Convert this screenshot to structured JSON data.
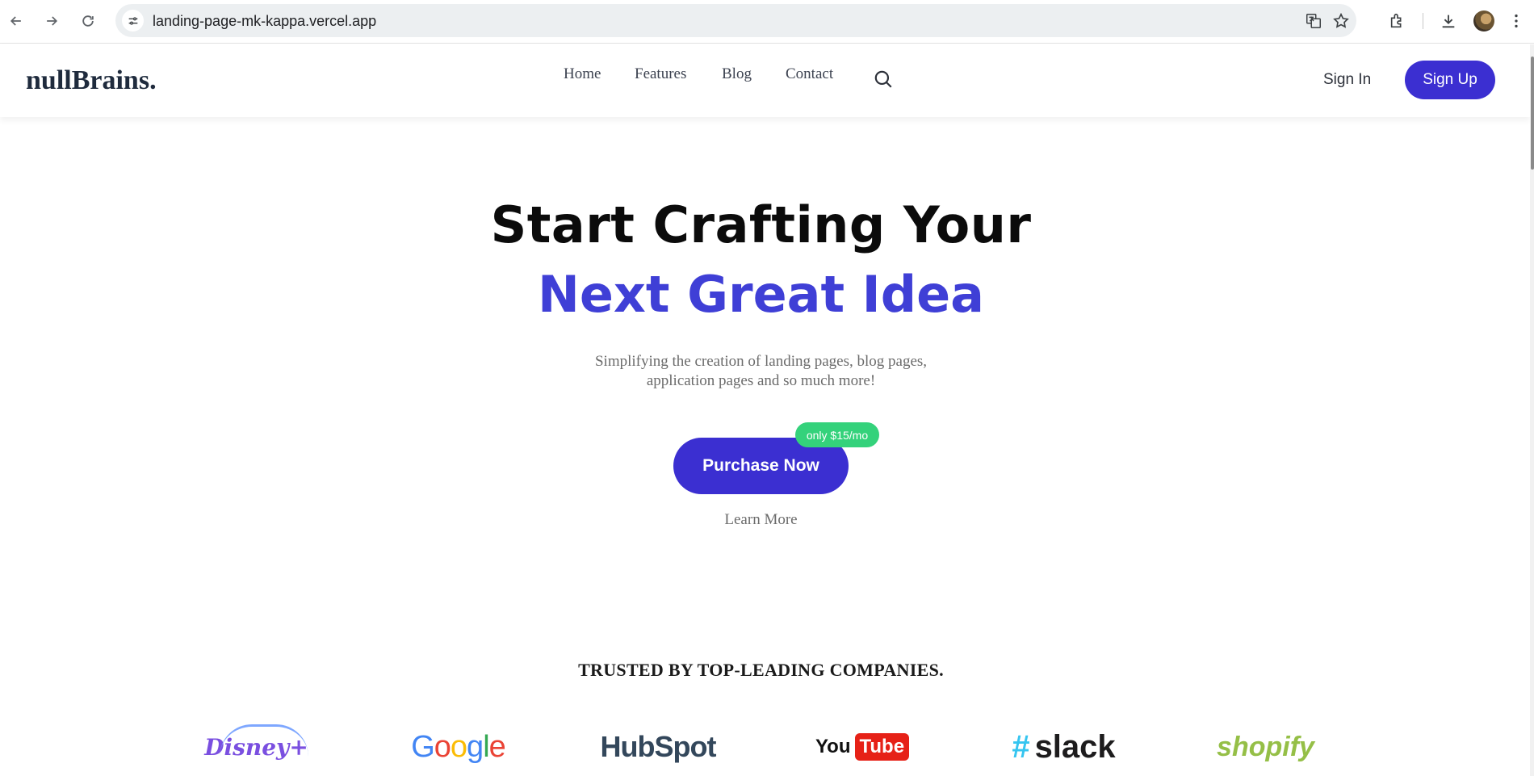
{
  "browser": {
    "url": "landing-page-mk-kappa.vercel.app"
  },
  "site": {
    "logo": "nullBrains.",
    "nav": [
      "Home",
      "Features",
      "Blog",
      "Contact"
    ],
    "sign_in": "Sign In",
    "sign_up": "Sign Up"
  },
  "hero": {
    "line1": "Start Crafting Your",
    "line2": "Next Great Idea",
    "subtitle_line1": "Simplifying the creation of landing pages, blog pages,",
    "subtitle_line2": "application pages and so much more!",
    "cta": "Purchase Now",
    "price_badge": "only $15/mo",
    "learn_more": "Learn More",
    "accent_color": "#3f3fd6",
    "button_color": "#3b2fd1",
    "badge_color": "#34d27b"
  },
  "trusted": {
    "heading": "TRUSTED BY TOP-LEADING COMPANIES.",
    "logos": {
      "disney": "Disney+",
      "google": [
        "G",
        "o",
        "o",
        "g",
        "l",
        "e"
      ],
      "hubspot": "HubSpot",
      "youtube_you": "You",
      "youtube_tube": "Tube",
      "slack": "slack",
      "shopify": "shopify"
    }
  }
}
